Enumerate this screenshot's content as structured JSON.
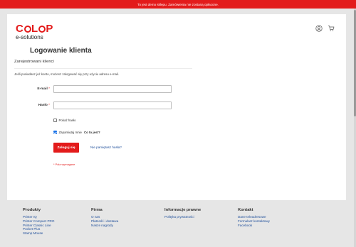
{
  "notice": {
    "text": "To jest demo sklepu. Zamówienia nie zostaną opłacone."
  },
  "logo": {
    "word_part1": "C",
    "word_part2": "L",
    "word_part3": "P",
    "subtitle": "e-solutions"
  },
  "header": {
    "icons": [
      "user-icon",
      "cart-icon"
    ]
  },
  "page": {
    "title": "Logowanie klienta",
    "section_title": "Zarejestrowani klienci",
    "intro": "Jeśli posiadasz już konto, możesz zalogować się przy użyciu adresu e-mail."
  },
  "form": {
    "email_label": "E-mail",
    "email_value": "",
    "password_label": "Hasło",
    "password_value": "",
    "required_mark": "*",
    "show_password_label": "Pokaż hasło",
    "show_password_checked": false,
    "remember_label": "Zapamiętaj mnie",
    "remember_checked": true,
    "what_is_this": "Co to jest?",
    "login_button": "Zaloguj się",
    "forgot_link": "Nie pamiętasz hasła?",
    "required_note": "* Pola wymagane"
  },
  "footer": {
    "columns": [
      {
        "title": "Produkty",
        "links": [
          "Printer IQ",
          "Printer Compact PRO",
          "Printer Classic Line",
          "Pocket Plus",
          "Stamp Mouse"
        ]
      },
      {
        "title": "Firma",
        "links": [
          "O nas",
          "Płatność i dostawa",
          "Nasze nagrody"
        ]
      },
      {
        "title": "Informacje prawne",
        "links": [
          "Polityka prywatności"
        ]
      },
      {
        "title": "Kontakt",
        "links": [
          "Dane teleadresowe",
          "Formularz kontaktowy",
          "Facebook"
        ]
      }
    ]
  },
  "colors": {
    "accent": "#e31b1b",
    "link": "#1e4e9a",
    "checkbox_checked": "#1a73e8"
  }
}
